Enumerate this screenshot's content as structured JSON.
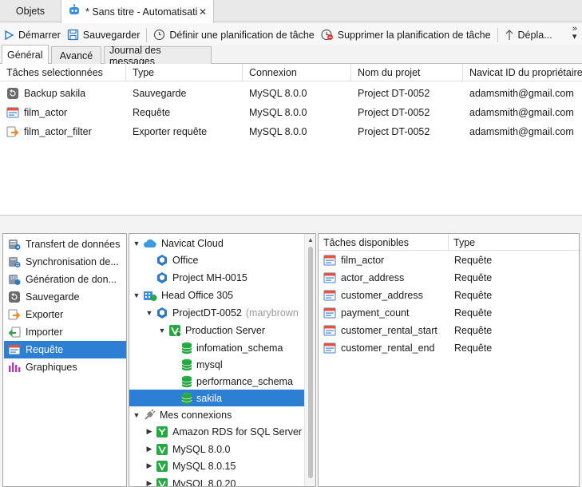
{
  "tabs": {
    "objets": "Objets",
    "document": "* Sans titre - Automatisation"
  },
  "toolbar": {
    "start": "Démarrer",
    "save": "Sauvegarder",
    "set_schedule": "Définir une planification de tâche",
    "delete_schedule": "Supprimer la planification de tâche",
    "move": "Dépla..."
  },
  "subtabs": [
    "Général",
    "Avancé",
    "Journal des messages"
  ],
  "tasks_table": {
    "headers": [
      "Tâches selectionnées",
      "Type",
      "Connexion",
      "Nom du projet",
      "Navicat ID du propriétaire"
    ],
    "rows": [
      {
        "name": "Backup sakila",
        "type": "Sauvegarde",
        "connection": "MySQL 8.0.0",
        "project": "Project DT-0052",
        "owner": "adamsmith@gmail.com",
        "icon": "backup-icon"
      },
      {
        "name": "film_actor",
        "type": "Requête",
        "connection": "MySQL 8.0.0",
        "project": "Project DT-0052",
        "owner": "adamsmith@gmail.com",
        "icon": "query-icon"
      },
      {
        "name": "film_actor_filter",
        "type": "Exporter requête",
        "connection": "MySQL 8.0.0",
        "project": "Project DT-0052",
        "owner": "adamsmith@gmail.com",
        "icon": "export-icon"
      }
    ]
  },
  "categories": [
    {
      "label": "Transfert de données",
      "icon": "transfer-icon"
    },
    {
      "label": "Synchronisation de...",
      "icon": "sync-icon"
    },
    {
      "label": "Génération de don...",
      "icon": "data-generation-icon"
    },
    {
      "label": "Sauvegarde",
      "icon": "backup-icon"
    },
    {
      "label": "Exporter",
      "icon": "export-icon"
    },
    {
      "label": "Importer",
      "icon": "import-icon"
    },
    {
      "label": "Requête",
      "icon": "query-icon"
    },
    {
      "label": "Graphiques",
      "icon": "charts-icon"
    }
  ],
  "selected_category": "Requête",
  "tree": {
    "navicat_cloud": "Navicat Cloud",
    "office": "Office",
    "project_mh": "Project MH-0015",
    "head_office": "Head Office 305",
    "project_dt": "ProjectDT-0052",
    "project_dt_owner": "(marybrown",
    "production_server": "Production Server",
    "db_infomation_schema": "infomation_schema",
    "db_mysql": "mysql",
    "db_performance_schema": "performance_schema",
    "db_sakila": "sakila",
    "my_connections": "Mes connexions",
    "conn_amazon": "Amazon RDS for SQL Server",
    "conn_mysql800": "MySQL 8.0.0",
    "conn_mysql8015": "MySQL 8.0.15",
    "conn_mysql8020": "MySQL 8.0.20"
  },
  "available_tasks": {
    "headers": [
      "Tâches disponibles",
      "Type"
    ],
    "rows": [
      {
        "name": "film_actor",
        "type": "Requête"
      },
      {
        "name": "actor_address",
        "type": "Requête"
      },
      {
        "name": "customer_address",
        "type": "Requête"
      },
      {
        "name": "payment_count",
        "type": "Requête"
      },
      {
        "name": "customer_rental_start",
        "type": "Requête"
      },
      {
        "name": "customer_rental_end",
        "type": "Requête"
      }
    ]
  },
  "colors": {
    "selection": "#2d7fd3",
    "accent_blue": "#2f78c4",
    "green": "#27a844",
    "orange": "#f08a1c"
  }
}
